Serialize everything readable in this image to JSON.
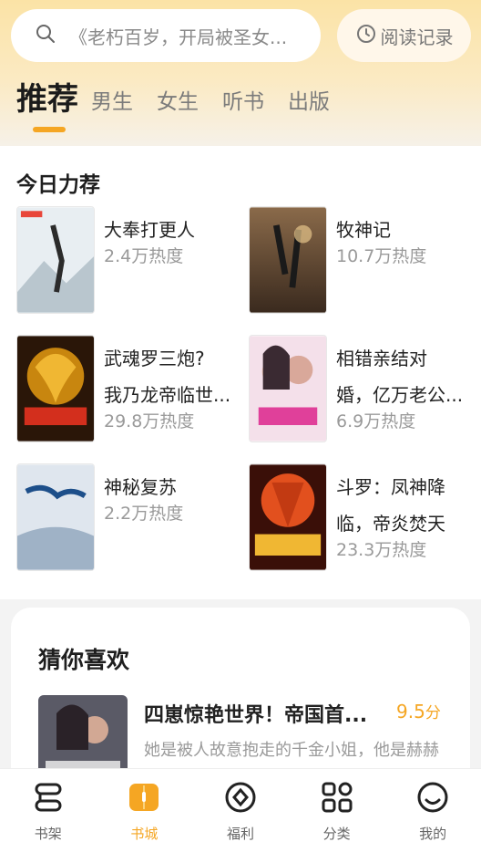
{
  "search": {
    "placeholder": "《老朽百岁，开局被圣女...",
    "icon": "search-icon"
  },
  "history_button": {
    "label": "阅读记录",
    "icon": "clock-icon"
  },
  "tabs": [
    {
      "label": "推荐",
      "active": true
    },
    {
      "label": "男生",
      "active": false
    },
    {
      "label": "女生",
      "active": false
    },
    {
      "label": "听书",
      "active": false
    },
    {
      "label": "出版",
      "active": false
    }
  ],
  "today": {
    "title": "今日力荐",
    "books": [
      {
        "title": "大奉打更人",
        "heat": "2.4万热度"
      },
      {
        "title": "牧神记",
        "heat": "10.7万热度"
      },
      {
        "title_line1": "武魂罗三炮?",
        "title_line2": "我乃龙帝临世...",
        "heat": "29.8万热度"
      },
      {
        "title_line1": "相错亲结对",
        "title_line2": "婚，亿万老公...",
        "heat": "6.9万热度"
      },
      {
        "title": "神秘复苏",
        "heat": "2.2万热度"
      },
      {
        "title_line1": "斗罗：凤神降",
        "title_line2": "临，帝炎焚天",
        "heat": "23.3万热度"
      }
    ]
  },
  "guess": {
    "title": "猜你喜欢",
    "book": {
      "title": "四崽惊艳世界！帝国首...",
      "score": "9.5",
      "score_unit": "分",
      "description": "她是被人故意抱走的千金小姐，他是赫赫"
    }
  },
  "nav": [
    {
      "label": "书架",
      "icon": "bookshelf-icon",
      "active": false
    },
    {
      "label": "书城",
      "icon": "bookstore-icon",
      "active": true
    },
    {
      "label": "福利",
      "icon": "welfare-icon",
      "active": false
    },
    {
      "label": "分类",
      "icon": "category-icon",
      "active": false
    },
    {
      "label": "我的",
      "icon": "profile-icon",
      "active": false
    }
  ],
  "colors": {
    "accent": "#f5a623",
    "header_gradient_top": "#fbe3a6"
  }
}
